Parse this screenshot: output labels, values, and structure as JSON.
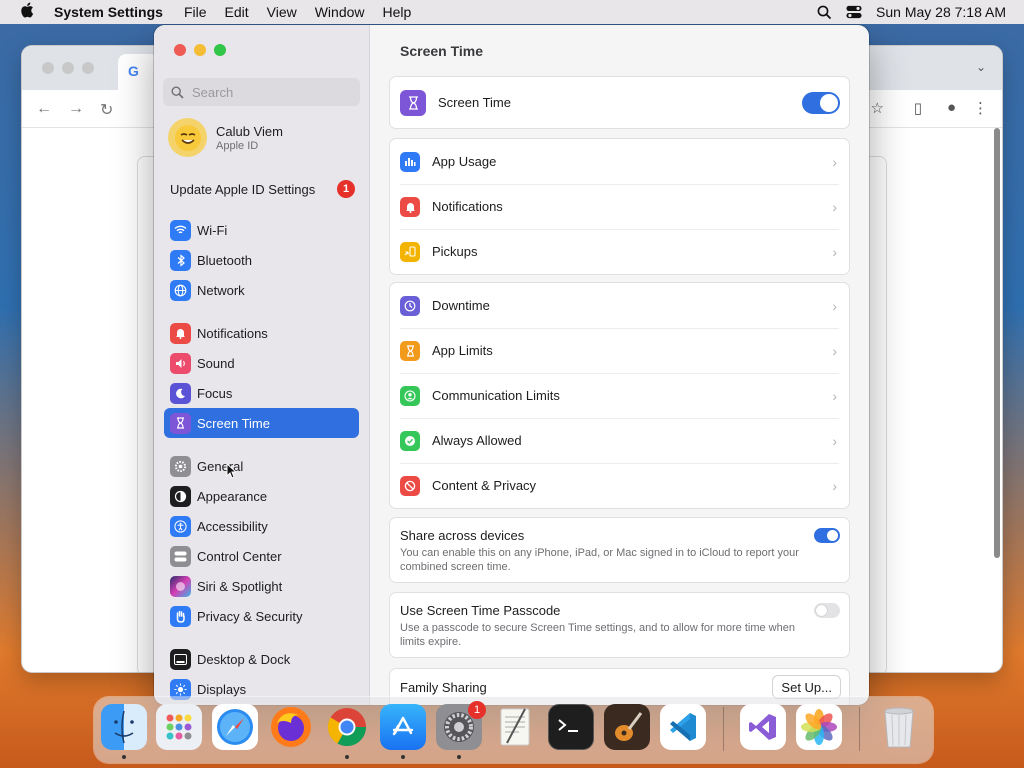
{
  "menubar": {
    "app_name": "System Settings",
    "menus": [
      "File",
      "Edit",
      "View",
      "Window",
      "Help"
    ],
    "clock": "Sun May 28  7:18 AM"
  },
  "settings": {
    "search_placeholder": "Search",
    "account": {
      "name": "Calub Viem",
      "sub": "Apple ID"
    },
    "update": {
      "label": "Update Apple ID Settings",
      "badge": "1"
    },
    "sidebar": [
      {
        "label": "Wi-Fi",
        "icon": "wifi-icon",
        "color": "#2f7bf6"
      },
      {
        "label": "Bluetooth",
        "icon": "bluetooth-icon",
        "color": "#2f7bf6"
      },
      {
        "label": "Network",
        "icon": "globe-icon",
        "color": "#2f7bf6"
      },
      {
        "label": "Notifications",
        "icon": "bell-icon",
        "color": "#ec4b45"
      },
      {
        "label": "Sound",
        "icon": "speaker-icon",
        "color": "#ec4b6c"
      },
      {
        "label": "Focus",
        "icon": "moon-icon",
        "color": "#5b53d6"
      },
      {
        "label": "Screen Time",
        "icon": "hourglass-icon",
        "color": "#7d55d7"
      },
      {
        "label": "General",
        "icon": "gear-icon",
        "color": "#8e8e93"
      },
      {
        "label": "Appearance",
        "icon": "appearance-icon",
        "color": "#1d1d1f"
      },
      {
        "label": "Accessibility",
        "icon": "accessibility-icon",
        "color": "#2f7bf6"
      },
      {
        "label": "Control Center",
        "icon": "control-center-icon",
        "color": "#8e8e93"
      },
      {
        "label": "Siri & Spotlight",
        "icon": "siri-icon",
        "color": "#b23ad1"
      },
      {
        "label": "Privacy & Security",
        "icon": "hand-icon",
        "color": "#2f7bf6"
      },
      {
        "label": "Desktop & Dock",
        "icon": "dock-icon",
        "color": "#1d1d1f"
      },
      {
        "label": "Displays",
        "icon": "sun-icon",
        "color": "#2f7bf6"
      }
    ],
    "pane_title": "Screen Time",
    "screen_time_row": {
      "label": "Screen Time",
      "enabled": true
    },
    "group_usage": [
      {
        "label": "App Usage",
        "icon": "chart-icon",
        "color": "#2f7bf6"
      },
      {
        "label": "Notifications",
        "icon": "bell-icon",
        "color": "#ec4b45"
      },
      {
        "label": "Pickups",
        "icon": "pickups-icon",
        "color": "#f2b400"
      }
    ],
    "group_limits": [
      {
        "label": "Downtime",
        "icon": "downtime-icon",
        "color": "#6a5fd6"
      },
      {
        "label": "App Limits",
        "icon": "hourglass-icon",
        "color": "#f29a1b"
      },
      {
        "label": "Communication Limits",
        "icon": "contact-icon",
        "color": "#35c759"
      },
      {
        "label": "Always Allowed",
        "icon": "check-icon",
        "color": "#35c759"
      },
      {
        "label": "Content & Privacy",
        "icon": "block-icon",
        "color": "#ec4b45"
      }
    ],
    "share": {
      "title": "Share across devices",
      "desc": "You can enable this on any iPhone, iPad, or Mac signed in to iCloud to report your combined screen time.",
      "enabled": true
    },
    "passcode": {
      "title": "Use Screen Time Passcode",
      "desc": "Use a passcode to secure Screen Time settings, and to allow for more time when limits expire.",
      "enabled": false
    },
    "family": {
      "title": "Family Sharing",
      "button": "Set Up..."
    }
  },
  "dock": {
    "apps": [
      "Finder",
      "Launchpad",
      "Safari",
      "Firefox",
      "Chrome",
      "App Store",
      "System Settings",
      "TextEdit",
      "Terminal",
      "GarageBand",
      "VS Code",
      "Visual Studio",
      "Photos",
      "Trash"
    ],
    "settings_badge": "1"
  }
}
